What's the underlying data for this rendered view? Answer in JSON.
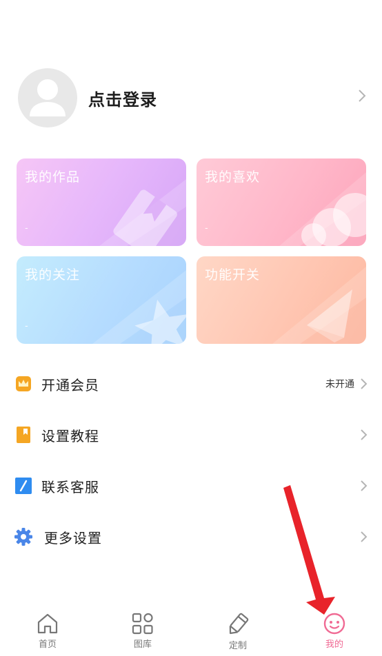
{
  "profile": {
    "login_label": "点击登录"
  },
  "cards": [
    {
      "title": "我的作品",
      "count": "-",
      "icon": "bookmark-icon"
    },
    {
      "title": "我的喜欢",
      "count": "-",
      "icon": "cloud-icon"
    },
    {
      "title": "我的关注",
      "count": "-",
      "icon": "star-icon"
    },
    {
      "title": "功能开关",
      "count": "",
      "icon": "paper-plane-icon"
    }
  ],
  "menu": [
    {
      "label": "开通会员",
      "status": "未开通",
      "icon": "crown-icon",
      "color": "#f5a623"
    },
    {
      "label": "设置教程",
      "status": "",
      "icon": "book-icon",
      "color": "#f5a623"
    },
    {
      "label": "联系客服",
      "status": "",
      "icon": "slash-icon",
      "color": "#2f8cf0"
    },
    {
      "label": "更多设置",
      "status": "",
      "icon": "gear-icon",
      "color": "#4a86e8"
    }
  ],
  "tabs": [
    {
      "label": "首页",
      "icon": "home-icon",
      "active": false
    },
    {
      "label": "图库",
      "icon": "gallery-icon",
      "active": false
    },
    {
      "label": "定制",
      "icon": "pen-icon",
      "active": false
    },
    {
      "label": "我的",
      "icon": "smiley-icon",
      "active": true
    }
  ],
  "colors": {
    "accent": "#f06a94",
    "annotation_arrow": "#e8232a"
  }
}
